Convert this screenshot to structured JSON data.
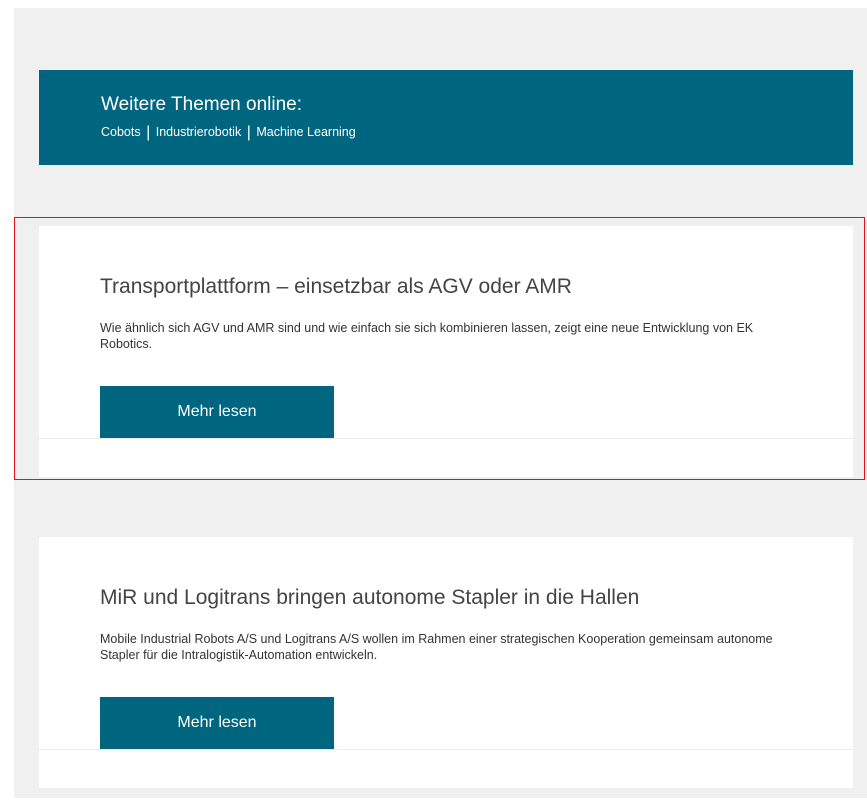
{
  "topics_banner": {
    "title": "Weitere Themen online:",
    "links": [
      "Cobots",
      "Industrierobotik",
      "Machine Learning"
    ],
    "separator": "|"
  },
  "articles": [
    {
      "title": "Transportplattform – einsetzbar als AGV oder AMR",
      "text": "Wie ähnlich sich AGV und AMR sind und wie einfach sie sich kombinieren lassen, zeigt eine neue Entwicklung von EK Robotics.",
      "button_label": "Mehr lesen"
    },
    {
      "title": "MiR und Logitrans bringen autonome Stapler in die Hallen",
      "text": "Mobile Industrial Robots A/S und Logitrans A/S wollen im Rahmen einer strategischen Kooperation gemeinsam autonome Stapler für die Intralogistik-Automation entwickeln.",
      "button_label": "Mehr lesen"
    }
  ],
  "colors": {
    "brand_teal": "#006680",
    "page_background": "#f0f0f0",
    "highlight_outline": "#e0131b"
  }
}
